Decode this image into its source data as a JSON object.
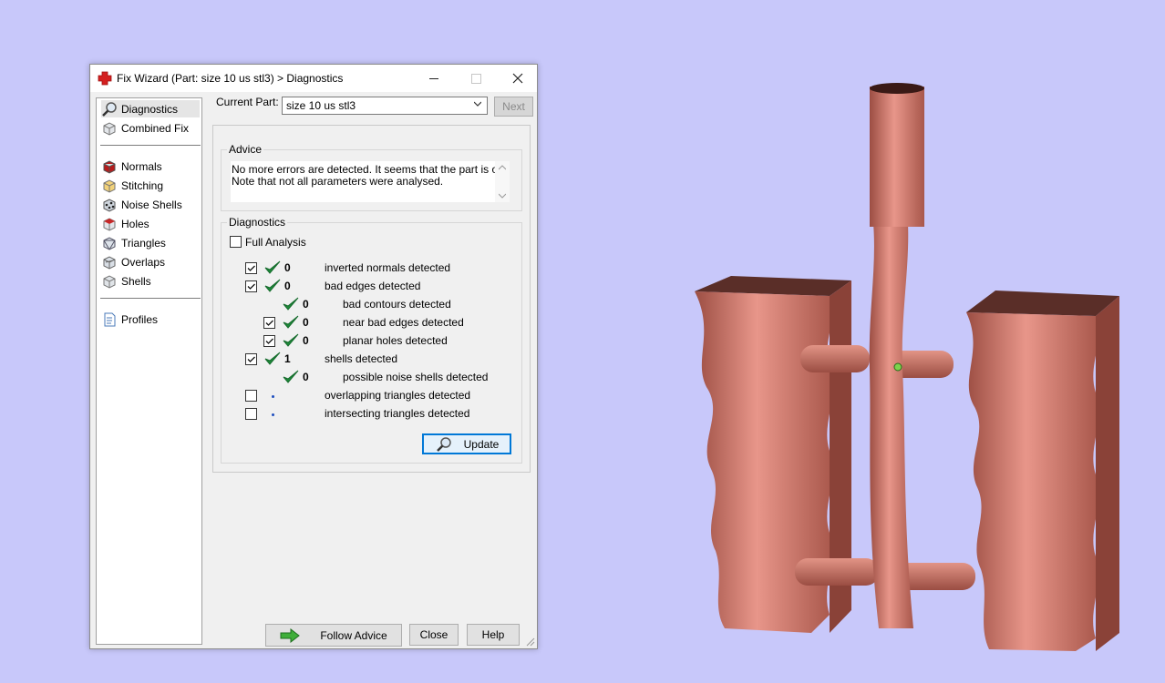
{
  "window": {
    "title": "Fix Wizard (Part: size 10 us stl3) > Diagnostics"
  },
  "sidebar": {
    "items": [
      {
        "label": "Diagnostics",
        "icon": "magnifier-icon"
      },
      {
        "label": "Combined Fix",
        "icon": "combined-fix-icon"
      },
      {
        "label": "Normals",
        "icon": "normals-icon"
      },
      {
        "label": "Stitching",
        "icon": "stitching-icon"
      },
      {
        "label": "Noise Shells",
        "icon": "noise-shells-icon"
      },
      {
        "label": "Holes",
        "icon": "holes-icon"
      },
      {
        "label": "Triangles",
        "icon": "triangles-icon"
      },
      {
        "label": "Overlaps",
        "icon": "overlaps-icon"
      },
      {
        "label": "Shells",
        "icon": "shells-icon"
      },
      {
        "label": "Profiles",
        "icon": "profiles-icon"
      }
    ]
  },
  "current_part": {
    "label": "Current Part:",
    "value": "size 10 us stl3",
    "next_label": "Next"
  },
  "advice": {
    "title": "Advice",
    "lines": [
      "No more errors are detected. It seems that the part is ok.",
      "Note that not all parameters were analysed."
    ]
  },
  "diagnostics": {
    "title": "Diagnostics",
    "full_analysis_label": "Full Analysis",
    "full_analysis_checked": false,
    "rows": [
      {
        "checked": true,
        "status": "ok",
        "count": "0",
        "label": "inverted normals detected"
      },
      {
        "checked": true,
        "status": "ok",
        "count": "0",
        "label": "bad edges detected"
      },
      {
        "checked": null,
        "status": "ok",
        "count": "0",
        "label": "bad contours detected"
      },
      {
        "checked": true,
        "status": "ok",
        "count": "0",
        "label": "near bad edges detected"
      },
      {
        "checked": true,
        "status": "ok",
        "count": "0",
        "label": "planar holes detected"
      },
      {
        "checked": true,
        "status": "ok",
        "count": "1",
        "label": "shells detected"
      },
      {
        "checked": null,
        "status": "ok",
        "count": "0",
        "label": "possible noise shells detected"
      },
      {
        "checked": false,
        "status": "not-analysed",
        "count": "",
        "label": "overlapping triangles detected"
      },
      {
        "checked": false,
        "status": "not-analysed",
        "count": "",
        "label": "intersecting triangles detected"
      }
    ],
    "update_label": "Update"
  },
  "footer": {
    "follow_advice_label": "Follow Advice",
    "close_label": "Close",
    "help_label": "Help"
  },
  "colors": {
    "background": "#c8c8fa",
    "model": "#c87a6c",
    "ok_green": "#1e8a3a",
    "accent": "#0078d7"
  }
}
